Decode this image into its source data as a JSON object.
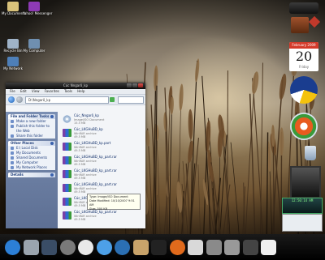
{
  "desktop_icons": [
    {
      "id": "my-documents",
      "label": "My Documents",
      "color": "#d9c27a"
    },
    {
      "id": "yahoo-messenger",
      "label": "Yahoo! Messenger",
      "color": "#8e3ab5"
    },
    {
      "id": "recycle-bin",
      "label": "Recycle Bin",
      "color": "#9fb3c8"
    },
    {
      "id": "computer",
      "label": "My Computer",
      "color": "#6f8fb0"
    },
    {
      "id": "network",
      "label": "My Network",
      "color": "#4e7fb8"
    }
  ],
  "explorer": {
    "title": "Cúc Nngarô_kp",
    "menu": [
      "File",
      "Edit",
      "View",
      "Favorites",
      "Tools",
      "Help"
    ],
    "address": "D:\\Nngarô_kp",
    "tasks": [
      {
        "header": "File and Folder Tasks",
        "items": [
          "Make a new folder",
          "Publish this folder to the Web",
          "Share this folder"
        ]
      },
      {
        "header": "Other Places",
        "items": [
          "E:\\ Local Disk",
          "My Documents",
          "Shared Documents",
          "My Computer",
          "My Network Places"
        ]
      },
      {
        "header": "Details",
        "items": []
      }
    ],
    "files": [
      {
        "name": "Cúc_Nngarô_kp",
        "type": "Image/ISO Document",
        "size": "15.5 MB",
        "icon": "cd"
      },
      {
        "name": "Cúc_LKGHuBD_kp",
        "type": "WinRAR archive",
        "size": "49.5 MB",
        "icon": "rar"
      },
      {
        "name": "Cúc_LKGHuBD_kp.part",
        "type": "WinRAR archive",
        "size": "49.5 MB",
        "icon": "rar"
      },
      {
        "name": "Cúc_LKGHuBD_kp_part.rar",
        "type": "WinRAR archive",
        "size": "49.5 MB",
        "icon": "rar"
      },
      {
        "name": "Cúc_LKGHuBD_kp_part.rar",
        "type": "WinRAR archive",
        "size": "49.5 MB",
        "icon": "rar"
      },
      {
        "name": "Cúc_LKGHuBD_kp_part.rar",
        "type": "WinRAR archive",
        "size": "49.5 MB",
        "icon": "rar"
      },
      {
        "name": "Cúc_LKGHuBD_kp_part.rar",
        "type": "WinRAR archive",
        "size": "49.5 MB",
        "icon": "rar"
      },
      {
        "name": "Cúc_LKGHuBD_kp_part.rar",
        "type": "WinRAR archive",
        "size": "49.5 MB",
        "icon": "rar"
      }
    ],
    "tooltip": {
      "type": "Type: Image/ISO Document",
      "date": "Date Modified: 10/10/2007 9:51 AM",
      "size": "Size: 500 KB"
    }
  },
  "sidebar": {
    "calendar": {
      "month": "February 2009",
      "day": "20",
      "weekday": "Friday"
    },
    "clock_text": "12:50:14 AM"
  },
  "dock": [
    {
      "id": "mac-finder",
      "color": "#2c7fd6",
      "round": true
    },
    {
      "id": "trash",
      "color": "#9aa4ae",
      "round": false
    },
    {
      "id": "monitor",
      "color": "#3a4d66",
      "round": false
    },
    {
      "id": "system-preferences",
      "color": "#7a7a7a",
      "round": true
    },
    {
      "id": "dashboard",
      "color": "#e9e9e9",
      "round": true
    },
    {
      "id": "finder",
      "color": "#4da0e8",
      "round": true
    },
    {
      "id": "network",
      "color": "#2b6fb3",
      "round": true
    },
    {
      "id": "chess",
      "color": "#c8a36a",
      "round": false
    },
    {
      "id": "terminal",
      "color": "#222",
      "round": false
    },
    {
      "id": "firefox",
      "color": "#e06a1c",
      "round": true
    },
    {
      "id": "utilities",
      "color": "#d9d9d9",
      "round": false
    },
    {
      "id": "calculator",
      "color": "#8a8a8a",
      "round": false
    },
    {
      "id": "printer",
      "color": "#999",
      "round": false
    },
    {
      "id": "instruments",
      "color": "#444",
      "round": false
    },
    {
      "id": "address-book",
      "color": "#f0f0f0",
      "round": false
    }
  ]
}
